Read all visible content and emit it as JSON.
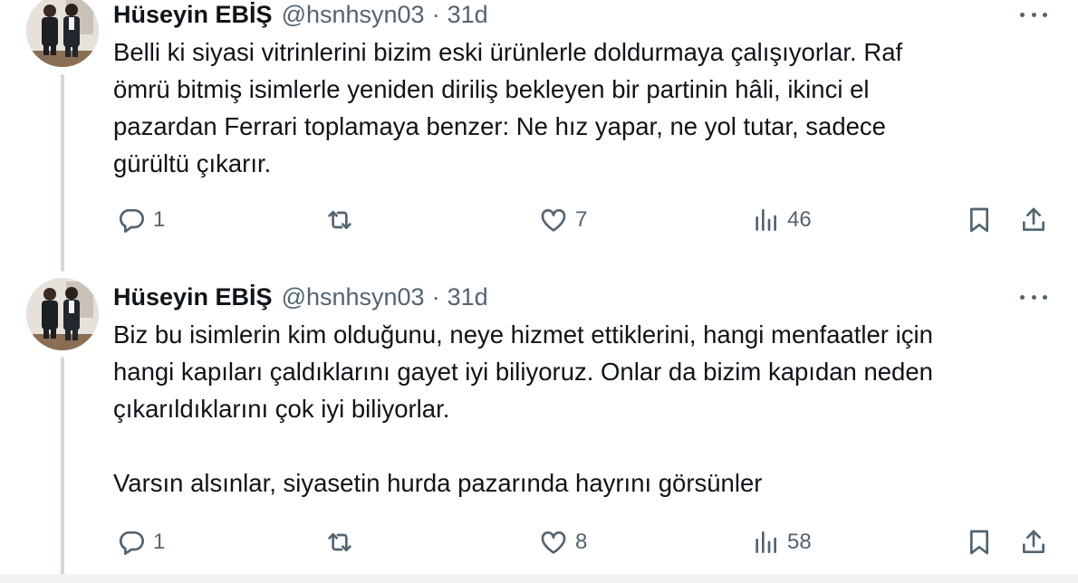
{
  "tweets": [
    {
      "author_name": "Hüseyin EBİŞ",
      "handle": "@hsnhsyn03",
      "separator": "·",
      "time": "31d",
      "text": "Belli ki siyasi vitrinlerini bizim eski ürünlerle doldurmaya çalışıyorlar. Raf\nömrü bitmiş isimlerle yeniden diriliş bekleyen bir partinin hâli, ikinci el\npazardan Ferrari toplamaya benzer: Ne hız yapar, ne yol tutar, sadece\ngürültü çıkarır.",
      "replies": "1",
      "retweets": "",
      "likes": "7",
      "views": "46"
    },
    {
      "author_name": "Hüseyin EBİŞ",
      "handle": "@hsnhsyn03",
      "separator": "·",
      "time": "31d",
      "text": "Biz bu isimlerin kim olduğunu, neye hizmet ettiklerini, hangi menfaatler için\nhangi kapıları çaldıklarını gayet iyi biliyoruz. Onlar da bizim kapıdan neden\nçıkarıldıklarını çok iyi biliyorlar.\n\nVarsın alsınlar, siyasetin hurda pazarında hayrını görsünler",
      "replies": "1",
      "retweets": "",
      "likes": "8",
      "views": "58"
    }
  ],
  "icons": {
    "reply": "reply-icon",
    "retweet": "retweet-icon",
    "like": "heart-icon",
    "views": "views-chart-icon",
    "bookmark": "bookmark-icon",
    "share": "share-icon",
    "more": "more-icon"
  },
  "colors": {
    "text": "#0f1419",
    "secondary": "#536471",
    "thread_line": "#cfd9de"
  }
}
